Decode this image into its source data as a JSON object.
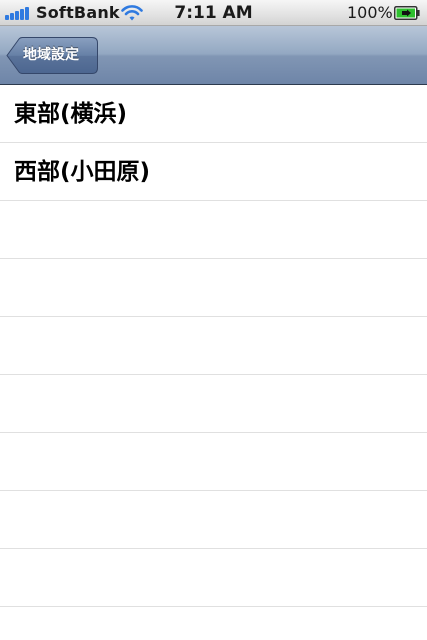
{
  "status_bar": {
    "carrier": "SoftBank",
    "time": "7:11 AM",
    "battery_percent": "100%",
    "signal_bars": 5,
    "wifi_icon": "wifi-icon",
    "battery_icon": "battery-charging-icon"
  },
  "nav_bar": {
    "back_label": "地域設定",
    "back_icon": "back-arrow-button"
  },
  "table": {
    "rows": [
      {
        "label": "東部(横浜)"
      },
      {
        "label": "西部(小田原)"
      },
      {
        "label": ""
      },
      {
        "label": ""
      },
      {
        "label": ""
      },
      {
        "label": ""
      },
      {
        "label": ""
      },
      {
        "label": ""
      },
      {
        "label": ""
      },
      {
        "label": ""
      }
    ]
  },
  "colors": {
    "nav_bar_top": "#b8c6d8",
    "nav_bar_bottom": "#6e85a8",
    "back_button": "#5a739a",
    "signal_blue": "#2f7ae0",
    "battery_green": "#2fc02f",
    "separator": "#e0e0e0"
  }
}
